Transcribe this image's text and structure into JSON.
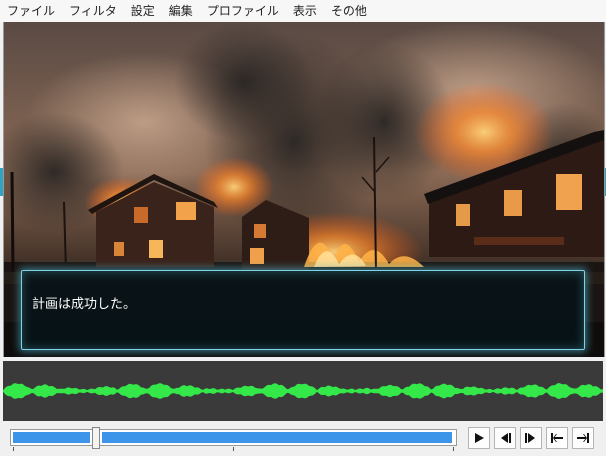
{
  "menu": [
    "ファイル",
    "フィルタ",
    "設定",
    "編集",
    "プロファイル",
    "表示",
    "その他"
  ],
  "dialog": {
    "text": "計画は成功した。"
  },
  "scene": {
    "description_icon": "burning-town-image"
  },
  "player": {
    "seek_progress": 0.19,
    "buttons": [
      {
        "name": "play-button",
        "icon": "play-icon"
      },
      {
        "name": "prev-frame-button",
        "icon": "step-back-icon"
      },
      {
        "name": "next-frame-button",
        "icon": "step-forward-icon"
      },
      {
        "name": "go-start-button",
        "icon": "skip-to-start-icon"
      },
      {
        "name": "go-end-button",
        "icon": "skip-to-end-icon"
      }
    ]
  },
  "colors": {
    "accent": "#3d95ea",
    "waveform": "#35e84a",
    "dialog_border": "#7fd3e6"
  }
}
